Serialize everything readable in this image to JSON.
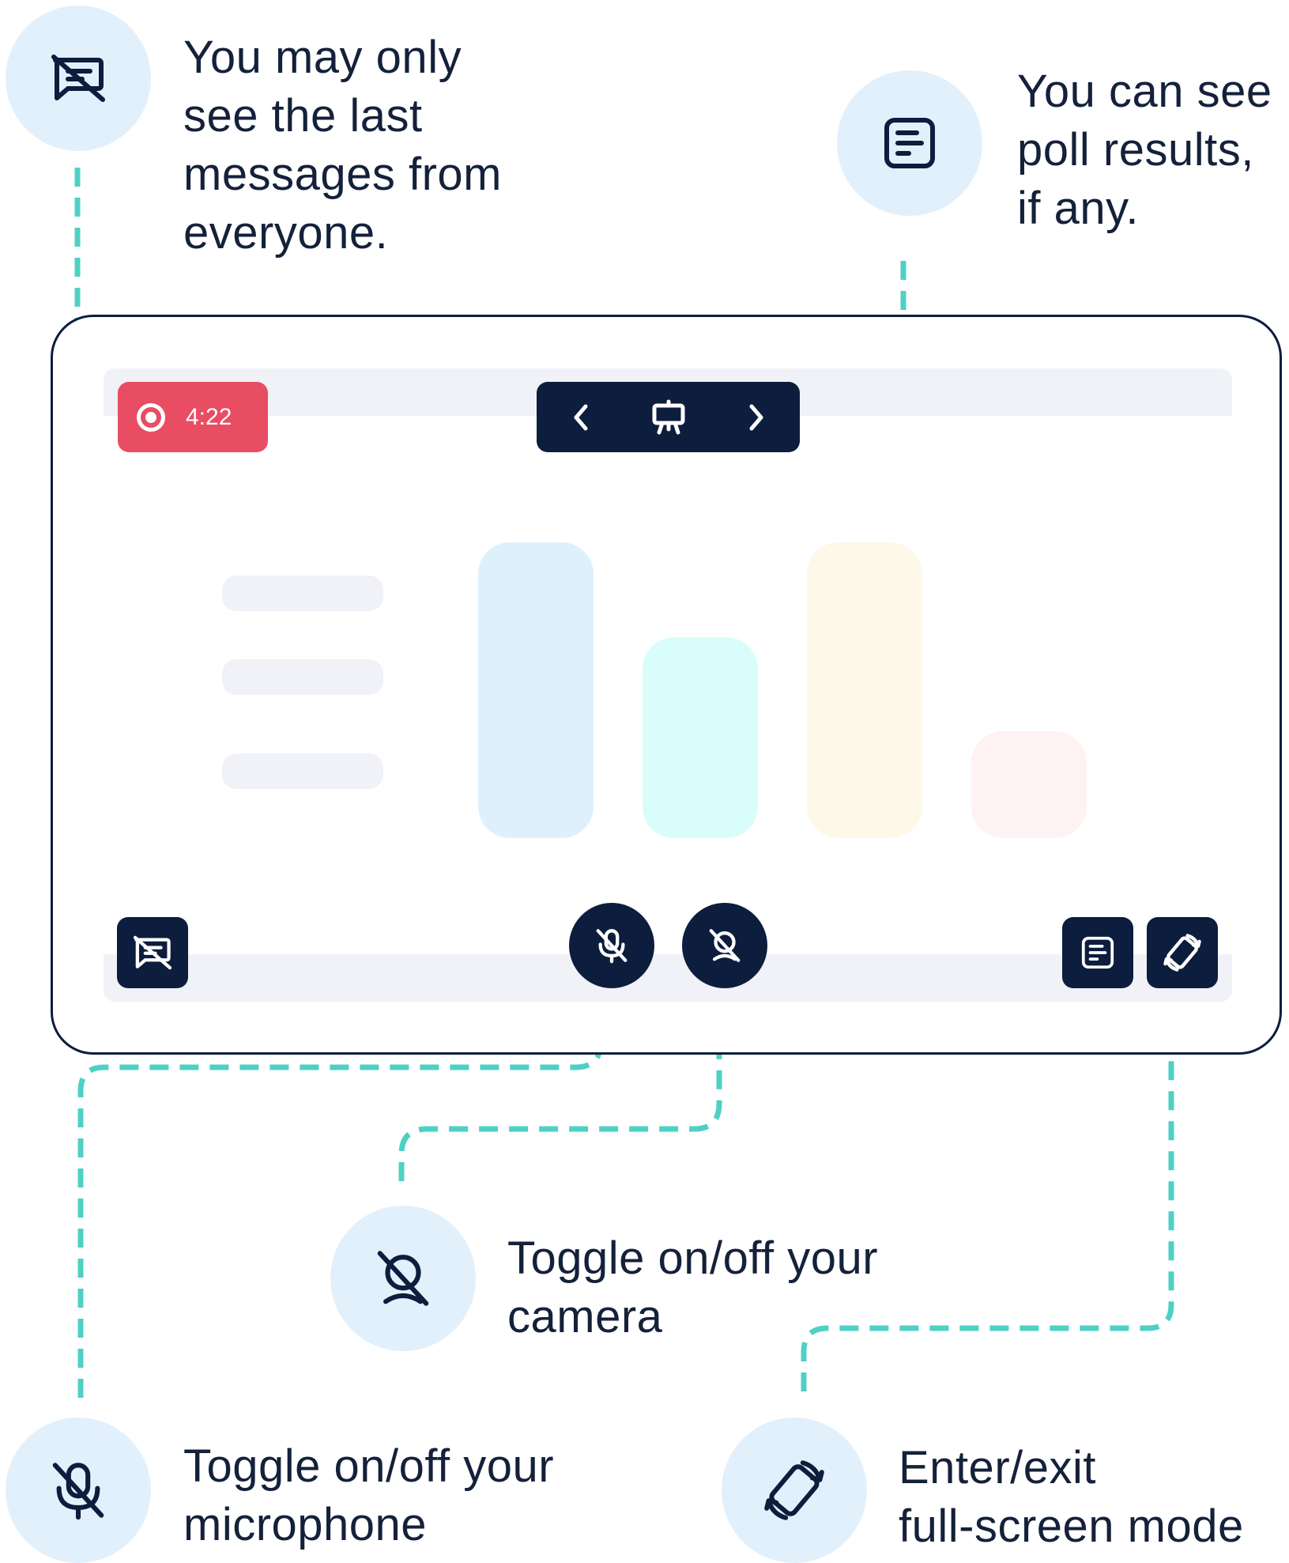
{
  "callouts": {
    "chat": {
      "lines": [
        "You may only",
        "see the last",
        "messages from",
        "everyone."
      ],
      "icon": "chat-off-icon"
    },
    "poll": {
      "lines": [
        "You can see",
        "poll results,",
        "if any."
      ],
      "icon": "poll-results-icon"
    },
    "camera": {
      "lines": [
        "Toggle on/off your",
        "camera"
      ],
      "icon": "camera-off-icon"
    },
    "microphone": {
      "lines": [
        "Toggle on/off your",
        "microphone"
      ],
      "icon": "microphone-off-icon"
    },
    "fullscreen": {
      "lines": [
        "Enter/exit",
        "full-screen mode"
      ],
      "icon": "rotate-device-icon"
    }
  },
  "screen": {
    "recording": {
      "time": "4:22",
      "icon": "record-icon"
    },
    "nav": {
      "prev_icon": "chevron-left-icon",
      "present_icon": "presentation-icon",
      "next_icon": "chevron-right-icon"
    },
    "toolbar": {
      "chat_icon": "chat-off-icon",
      "mic_icon": "microphone-off-icon",
      "camera_icon": "camera-off-icon",
      "poll_icon": "poll-results-icon",
      "fullscreen_icon": "rotate-device-icon"
    },
    "placeholder_chart": {
      "bars": [
        {
          "value": 1.0,
          "color": "#dff0fd"
        },
        {
          "value": 0.68,
          "color": "#d8fdfb"
        },
        {
          "value": 1.0,
          "color": "#fef8e8"
        },
        {
          "value": 0.36,
          "color": "#fef2f2"
        }
      ]
    }
  },
  "colors": {
    "navy": "#0c1d3d",
    "icon_bg": "#e2f0fc",
    "record_red": "#e94d63",
    "connector_teal": "#4fd0c5",
    "strip_gray": "#f0f2f7"
  }
}
